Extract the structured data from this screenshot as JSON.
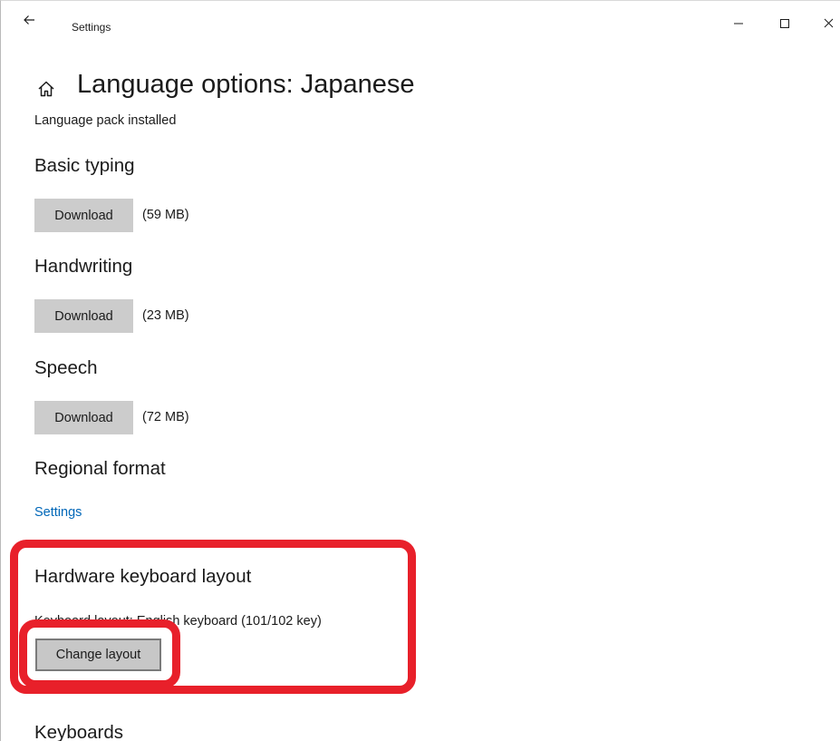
{
  "window": {
    "title": "Settings",
    "icons": {
      "back": "arrow-left-icon",
      "minimize": "minimize-icon",
      "maximize": "maximize-icon",
      "close": "close-icon",
      "home": "home-icon"
    }
  },
  "page": {
    "title": "Language options: Japanese",
    "status": "Language pack installed"
  },
  "sections": {
    "basic_typing": {
      "heading": "Basic typing",
      "button_label": "Download",
      "size": "(59 MB)"
    },
    "handwriting": {
      "heading": "Handwriting",
      "button_label": "Download",
      "size": "(23 MB)"
    },
    "speech": {
      "heading": "Speech",
      "button_label": "Download",
      "size": "(72 MB)"
    },
    "regional_format": {
      "heading": "Regional format",
      "link_label": "Settings"
    },
    "hardware_keyboard": {
      "heading": "Hardware keyboard layout",
      "layout_text": "Keyboard layout: English keyboard (101/102 key)",
      "button_label": "Change layout"
    },
    "keyboards": {
      "heading": "Keyboards"
    }
  },
  "colors": {
    "accent_link": "#0067b8",
    "highlight": "#e8202a",
    "button_bg": "#cccccc"
  }
}
